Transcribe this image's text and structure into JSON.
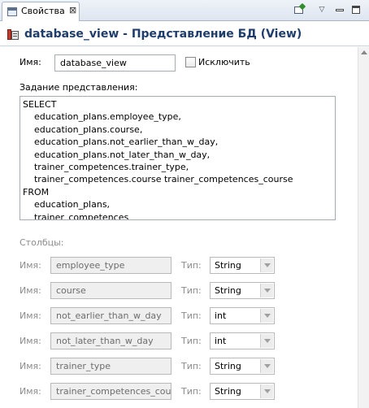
{
  "tab": {
    "title": "Свойства",
    "icon": "properties-icon",
    "close_glyph": "⊠"
  },
  "toolbar": {
    "pin_icon": "pin-icon",
    "menu_glyph": "▽",
    "minimize_icon": "minimize-icon",
    "maximize_icon": "maximize-icon"
  },
  "header": {
    "title": "database_view - Представление БД (View)",
    "icon": "database-view-icon"
  },
  "form": {
    "name_label": "Имя:",
    "name_value": "database_view",
    "exclude_label": "Исключить",
    "exclude_checked": false,
    "definition_label": "Задание представления:",
    "definition_text": "SELECT\n    education_plans.employee_type,\n    education_plans.course,\n    education_plans.not_earlier_than_w_day,\n    education_plans.not_later_than_w_day,\n    trainer_competences.trainer_type,\n    trainer_competences.course trainer_competences_course\nFROM\n    education_plans,\n    trainer_competences",
    "columns_label": "Столбцы:",
    "col_name_label": "Имя:",
    "col_type_label": "Тип:"
  },
  "columns": [
    {
      "name": "employee_type",
      "type": "String"
    },
    {
      "name": "course",
      "type": "String"
    },
    {
      "name": "not_earlier_than_w_day",
      "type": "int"
    },
    {
      "name": "not_later_than_w_day",
      "type": "int"
    },
    {
      "name": "trainer_type",
      "type": "String"
    },
    {
      "name": "trainer_competences_course",
      "type": "String"
    }
  ],
  "colors": {
    "header_title": "#1f3d6b",
    "disabled_text": "#8c8c8c"
  }
}
